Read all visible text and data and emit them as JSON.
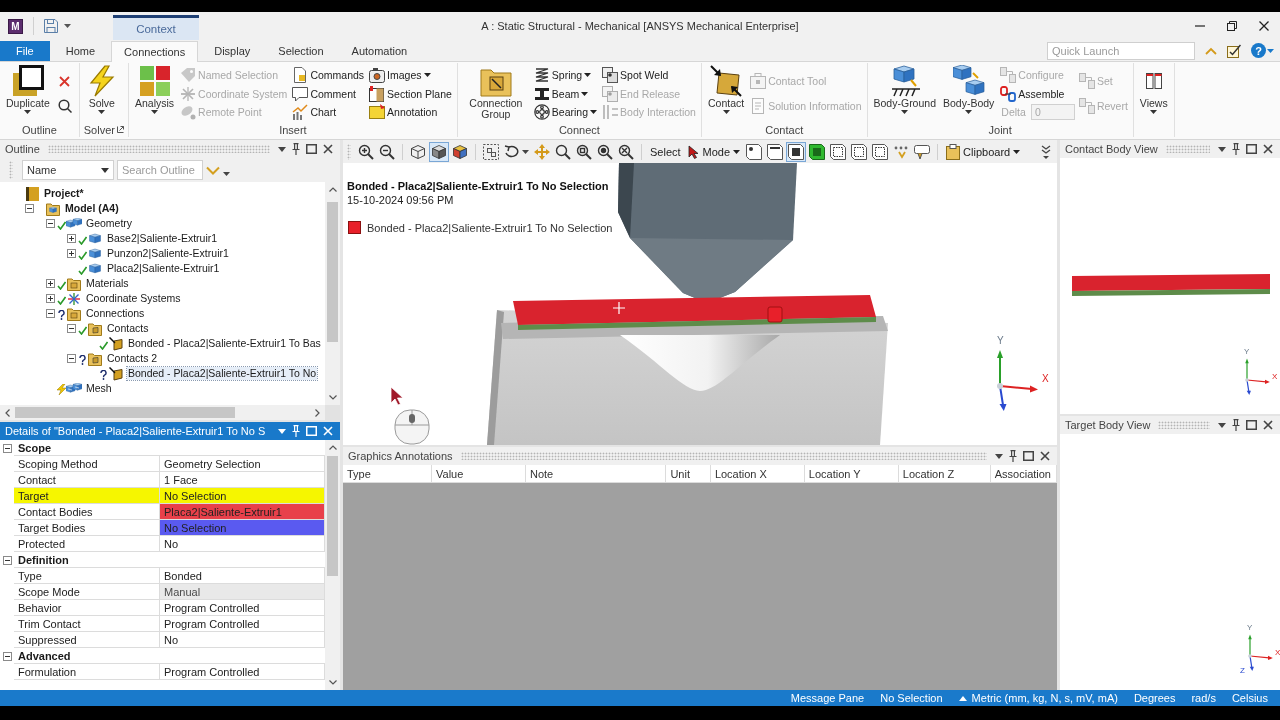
{
  "title_bar": {
    "app_badge": "M",
    "context_tab": "Context",
    "title": "A : Static Structural - Mechanical [ANSYS Mechanical Enterprise]"
  },
  "ribbon_tabs": [
    {
      "label": "File",
      "kind": "file",
      "selected": false
    },
    {
      "label": "Home",
      "kind": "tab",
      "selected": false
    },
    {
      "label": "Connections",
      "kind": "tab",
      "selected": true
    },
    {
      "label": "Display",
      "kind": "tab",
      "selected": false
    },
    {
      "label": "Selection",
      "kind": "tab",
      "selected": false
    },
    {
      "label": "Automation",
      "kind": "tab",
      "selected": false
    }
  ],
  "quick_launch": {
    "placeholder": "Quick Launch",
    "help": "?"
  },
  "ribbon_groups": [
    {
      "label": "Outline",
      "items": [
        {
          "kind": "large",
          "label": "Duplicate",
          "dropdown": true,
          "disabled": false
        },
        {
          "kind": "tool",
          "disabled": false
        },
        {
          "kind": "tool",
          "disabled": false
        }
      ]
    },
    {
      "label": "Solver",
      "launcher": true,
      "items": [
        {
          "kind": "large",
          "label": "Solve",
          "dropdown": true,
          "disabled": false
        }
      ]
    },
    {
      "label": "Insert",
      "items": [
        {
          "kind": "large",
          "label": "Analysis",
          "dropdown": true,
          "disabled": false
        },
        {
          "kind": "small",
          "label": "Named Selection",
          "dropdown": false,
          "disabled": true
        },
        {
          "kind": "small",
          "label": "Coordinate System",
          "dropdown": false,
          "disabled": true
        },
        {
          "kind": "small",
          "label": "Remote Point",
          "dropdown": false,
          "disabled": true
        },
        {
          "kind": "small",
          "label": "Commands",
          "dropdown": false,
          "disabled": false
        },
        {
          "kind": "small",
          "label": "Comment",
          "dropdown": false,
          "disabled": false
        },
        {
          "kind": "small",
          "label": "Chart",
          "dropdown": false,
          "disabled": false
        },
        {
          "kind": "small",
          "label": "Images",
          "dropdown": true,
          "disabled": false
        },
        {
          "kind": "small",
          "label": "Section Plane",
          "dropdown": false,
          "disabled": false
        },
        {
          "kind": "small",
          "label": "Annotation",
          "dropdown": false,
          "disabled": false
        }
      ]
    },
    {
      "label": "Connect",
      "items": [
        {
          "kind": "large",
          "label": "Connection Group",
          "dropdown": false,
          "disabled": false
        },
        {
          "kind": "small",
          "label": "Spring",
          "dropdown": true,
          "disabled": false
        },
        {
          "kind": "small",
          "label": "Beam",
          "dropdown": true,
          "disabled": false
        },
        {
          "kind": "small",
          "label": "Bearing",
          "dropdown": true,
          "disabled": false
        },
        {
          "kind": "small",
          "label": "Spot Weld",
          "dropdown": false,
          "disabled": false
        },
        {
          "kind": "small",
          "label": "End Release",
          "dropdown": false,
          "disabled": true
        },
        {
          "kind": "small",
          "label": "Body Interaction",
          "dropdown": false,
          "disabled": true
        }
      ]
    },
    {
      "label": "Contact",
      "items": [
        {
          "kind": "large",
          "label": "Contact",
          "dropdown": true,
          "disabled": false
        },
        {
          "kind": "small",
          "label": "Contact Tool",
          "dropdown": false,
          "disabled": true
        },
        {
          "kind": "small",
          "label": "Solution Information",
          "dropdown": false,
          "disabled": true
        }
      ]
    },
    {
      "label": "Joint",
      "items": [
        {
          "kind": "large",
          "label": "Body-Ground",
          "dropdown": true,
          "disabled": false
        },
        {
          "kind": "large",
          "label": "Body-Body",
          "dropdown": true,
          "disabled": false
        },
        {
          "kind": "small",
          "label": "Configure",
          "dropdown": false,
          "disabled": true
        },
        {
          "kind": "small",
          "label": "Assemble",
          "dropdown": false,
          "disabled": false
        },
        {
          "kind": "field",
          "label": "Delta",
          "value": "0",
          "disabled": true
        },
        {
          "kind": "small",
          "label": "Set",
          "dropdown": false,
          "disabled": true
        },
        {
          "kind": "small",
          "label": "Revert",
          "dropdown": false,
          "disabled": true
        }
      ]
    },
    {
      "items": [
        {
          "kind": "large",
          "label": "Views",
          "dropdown": true,
          "disabled": false
        }
      ]
    }
  ],
  "outline": {
    "title": "Outline",
    "name_filter": "Name",
    "search": {
      "placeholder": "Search Outline"
    },
    "tree": [
      {
        "label": "Project*",
        "kind": "project",
        "selected": false,
        "children": [
          {
            "label": "Model (A4)",
            "kind": "model",
            "expanded": true,
            "selected": false,
            "children": [
              {
                "label": "Geometry",
                "kind": "geometry",
                "defined": true,
                "needs_update": false,
                "expanded": true,
                "selected": false,
                "children": [
                  {
                    "label": "Base2|Saliente-Extruir1",
                    "kind": "body",
                    "defined": true,
                    "needs_update": false,
                    "expanded": false,
                    "selected": false
                  },
                  {
                    "label": "Punzon2|Saliente-Extruir1",
                    "kind": "body",
                    "defined": true,
                    "needs_update": false,
                    "expanded": false,
                    "selected": false
                  },
                  {
                    "label": "Placa2|Saliente-Extruir1",
                    "kind": "body",
                    "defined": true,
                    "needs_update": false,
                    "selected": false
                  }
                ]
              },
              {
                "label": "Materials",
                "kind": "materials",
                "defined": true,
                "needs_update": false,
                "expanded": false,
                "selected": false
              },
              {
                "label": "Coordinate Systems",
                "kind": "coordinates",
                "defined": true,
                "needs_update": false,
                "expanded": false,
                "selected": false
              },
              {
                "label": "Connections",
                "kind": "connections",
                "defined": false,
                "needs_update": false,
                "expanded": true,
                "selected": false,
                "children": [
                  {
                    "label": "Contacts",
                    "kind": "contacts",
                    "defined": true,
                    "needs_update": false,
                    "expanded": true,
                    "selected": false,
                    "children": [
                      {
                        "label": "Bonded - Placa2|Saliente-Extruir1 To Bas",
                        "kind": "contact",
                        "defined": true,
                        "needs_update": false,
                        "selected": false
                      }
                    ]
                  },
                  {
                    "label": "Contacts 2",
                    "kind": "contacts",
                    "defined": false,
                    "needs_update": false,
                    "expanded": true,
                    "selected": false,
                    "children": [
                      {
                        "label": "Bonded - Placa2|Saliente-Extruir1 To No",
                        "kind": "contact",
                        "defined": false,
                        "needs_update": false,
                        "selected": true
                      }
                    ]
                  }
                ]
              },
              {
                "label": "Mesh",
                "kind": "mesh",
                "needs_update": true,
                "selected": false
              }
            ]
          }
        ]
      }
    ]
  },
  "details": {
    "title": "Details of \"Bonded - Placa2|Saliente-Extruir1 To No S",
    "sections": [
      {
        "label": "Scope",
        "expanded": true,
        "rows": [
          {
            "label": "Scoping Method",
            "value": "Geometry Selection",
            "read_only": false
          },
          {
            "label": "Contact",
            "value": "1 Face",
            "read_only": false
          },
          {
            "label": "Target",
            "value": "No Selection",
            "read_only": false,
            "color": "#f6f600",
            "label_highlighted": true
          },
          {
            "label": "Contact Bodies",
            "value": "Placa2|Saliente-Extruir1",
            "read_only": false,
            "color": "#e8404a",
            "label_highlighted": false
          },
          {
            "label": "Target Bodies",
            "value": "No Selection",
            "read_only": false,
            "color": "#5a5af0",
            "label_highlighted": false
          },
          {
            "label": "Protected",
            "value": "No",
            "read_only": false
          }
        ]
      },
      {
        "label": "Definition",
        "expanded": true,
        "rows": [
          {
            "label": "Type",
            "value": "Bonded",
            "read_only": false
          },
          {
            "label": "Scope Mode",
            "value": "Manual",
            "read_only": true
          },
          {
            "label": "Behavior",
            "value": "Program Controlled",
            "read_only": false
          },
          {
            "label": "Trim Contact",
            "value": "Program Controlled",
            "read_only": false
          },
          {
            "label": "Suppressed",
            "value": "No",
            "read_only": false
          }
        ]
      },
      {
        "label": "Advanced",
        "expanded": true,
        "rows": [
          {
            "label": "Formulation",
            "value": "Program Controlled",
            "read_only": false
          }
        ]
      }
    ]
  },
  "graphics_toolbar": {
    "tools": [
      {
        "selected": false
      },
      {
        "selected": false
      },
      {
        "selected": false
      },
      {
        "selected": true
      },
      {
        "selected": false
      },
      {
        "selected": false
      },
      {
        "selected": false
      },
      {
        "selected": false
      },
      {
        "selected": false
      },
      {
        "selected": false
      },
      {
        "selected": false
      },
      {
        "selected": false
      },
      {
        "selected": false
      },
      {
        "selected": false
      },
      {
        "selected": true
      },
      {
        "selected": false
      },
      {
        "selected": false
      },
      {
        "selected": false
      },
      {
        "selected": false
      },
      {
        "selected": false
      },
      {
        "selected": false
      }
    ],
    "select_label": "Select",
    "mode_label": "Mode",
    "clipboard_label": "Clipboard"
  },
  "graphics": {
    "heading": "Bonded - Placa2|Saliente-Extruir1 To No Selection",
    "timestamp": "15-10-2024 09:56 PM",
    "legend": [
      {
        "label": "Bonded - Placa2|Saliente-Extruir1 To No Selection",
        "color": "#e8202a"
      }
    ],
    "triad_labels": [
      "Y",
      "X"
    ]
  },
  "graphics_annotations": {
    "title": "Graphics Annotations",
    "columns": [
      "Type",
      "Value",
      "Note",
      "Unit",
      "Location X",
      "Location Y",
      "Location Z",
      "Association"
    ]
  },
  "contact_body_view": {
    "title": "Contact Body View",
    "triad_labels": [
      "Y",
      "X"
    ]
  },
  "target_body_view": {
    "title": "Target Body View",
    "triad_labels": [
      "Y",
      "X",
      "Z"
    ]
  },
  "status_bar": {
    "items": [
      {
        "label": "Message Pane",
        "kind": "text"
      },
      {
        "label": "No Selection",
        "kind": "text"
      },
      {
        "label": "Metric (mm, kg, N, s, mV, mA)",
        "kind": "menu"
      },
      {
        "label": "Degrees",
        "kind": "text"
      },
      {
        "label": "rad/s",
        "kind": "text"
      },
      {
        "label": "Celsius",
        "kind": "text"
      }
    ]
  }
}
